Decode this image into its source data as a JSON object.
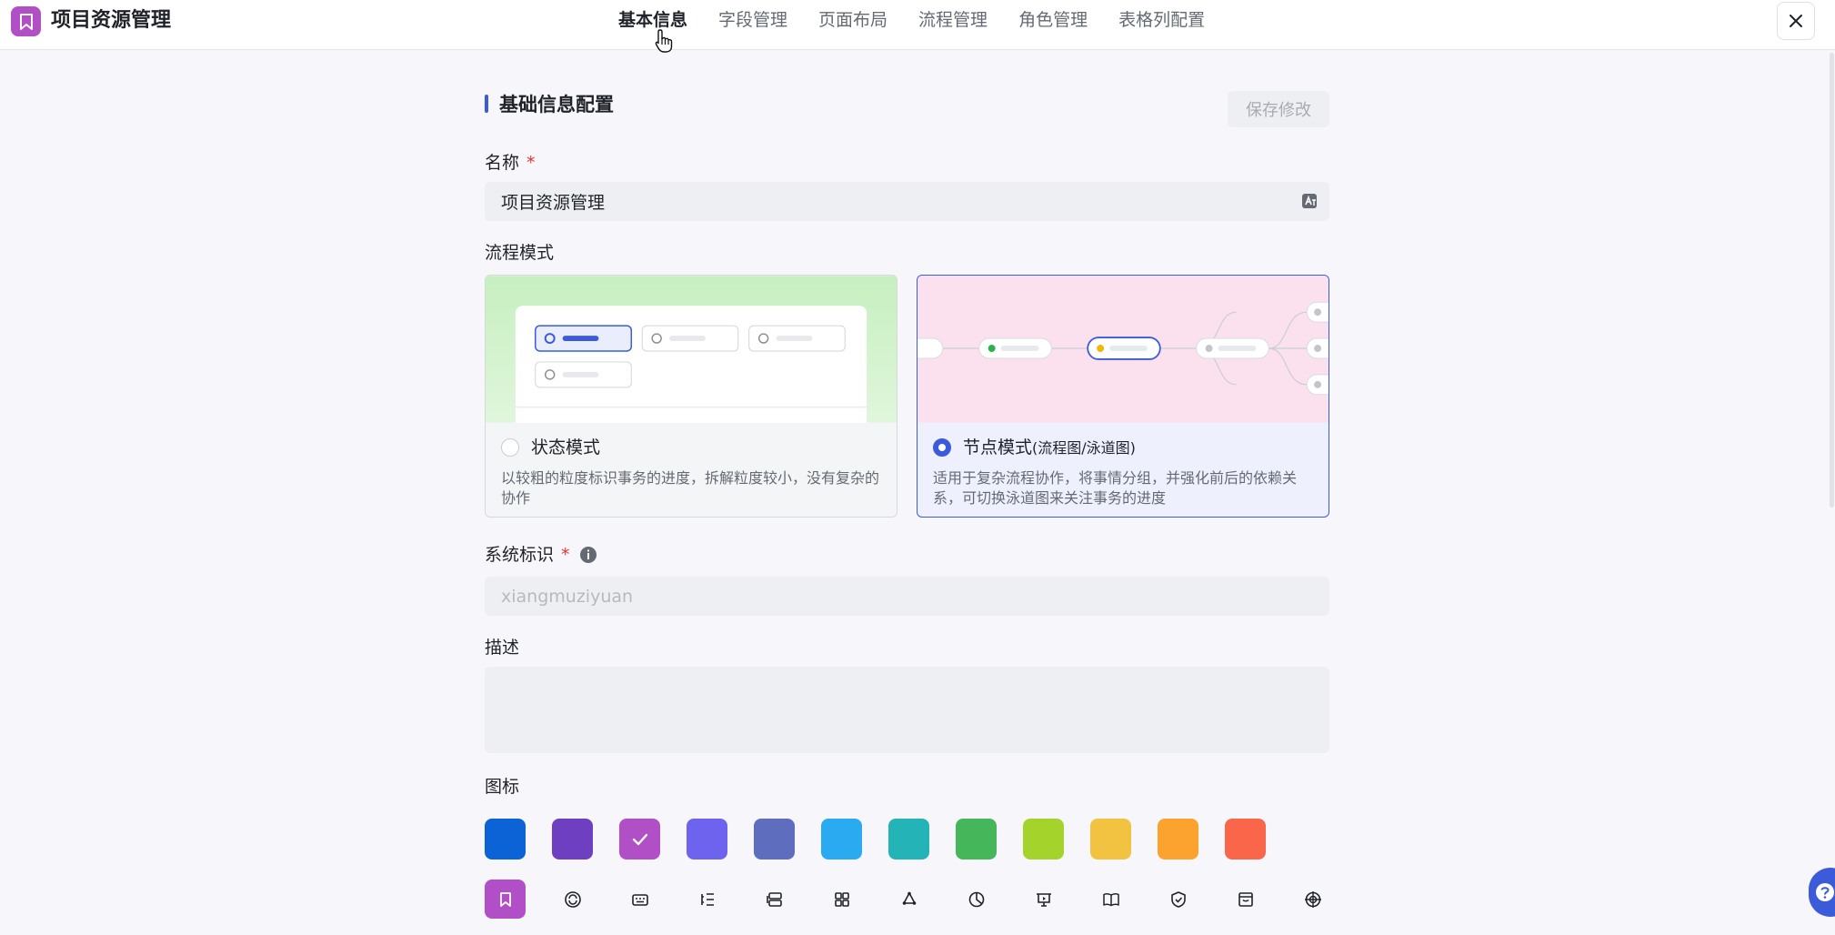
{
  "header": {
    "app_title": "项目资源管理",
    "tabs": [
      "基本信息",
      "字段管理",
      "页面布局",
      "流程管理",
      "角色管理",
      "表格列配置"
    ],
    "active_tab": 0
  },
  "section": {
    "title": "基础信息配置",
    "save_label": "保存修改"
  },
  "form": {
    "name_label": "名称",
    "name_value": "项目资源管理",
    "required_mark": "*",
    "flow_mode_label": "流程模式",
    "modes": [
      {
        "title": "状态模式",
        "subtitle": "",
        "desc": "以较粗的粒度标识事务的进度，拆解粒度较小，没有复杂的协作",
        "selected": false
      },
      {
        "title": "节点模式",
        "subtitle": "(流程图/泳道图)",
        "desc": "适用于复杂流程协作，将事情分组，并强化前后的依赖关系，可切换泳道图来关注事务的进度",
        "selected": true
      }
    ],
    "system_id_label": "系统标识",
    "system_id_placeholder": "xiangmuziyuan",
    "desc_label": "描述",
    "icon_label": "图标"
  },
  "colors": [
    "#0b63d6",
    "#6f3fc2",
    "#b14fc6",
    "#6e63ee",
    "#5f6dbf",
    "#2aaaf0",
    "#24b3b7",
    "#46b65a",
    "#a4d42c",
    "#f2c341",
    "#fba32e",
    "#fa6649"
  ],
  "selected_color": 2,
  "icons": [
    "bookmark-icon",
    "refresh-icon",
    "keyboard-icon",
    "list-icon",
    "layers-icon",
    "grid-icon",
    "recycle-icon",
    "pie-icon",
    "presentation-icon",
    "book-icon",
    "shield-icon",
    "archive-icon",
    "target-icon"
  ],
  "selected_icon": 0
}
